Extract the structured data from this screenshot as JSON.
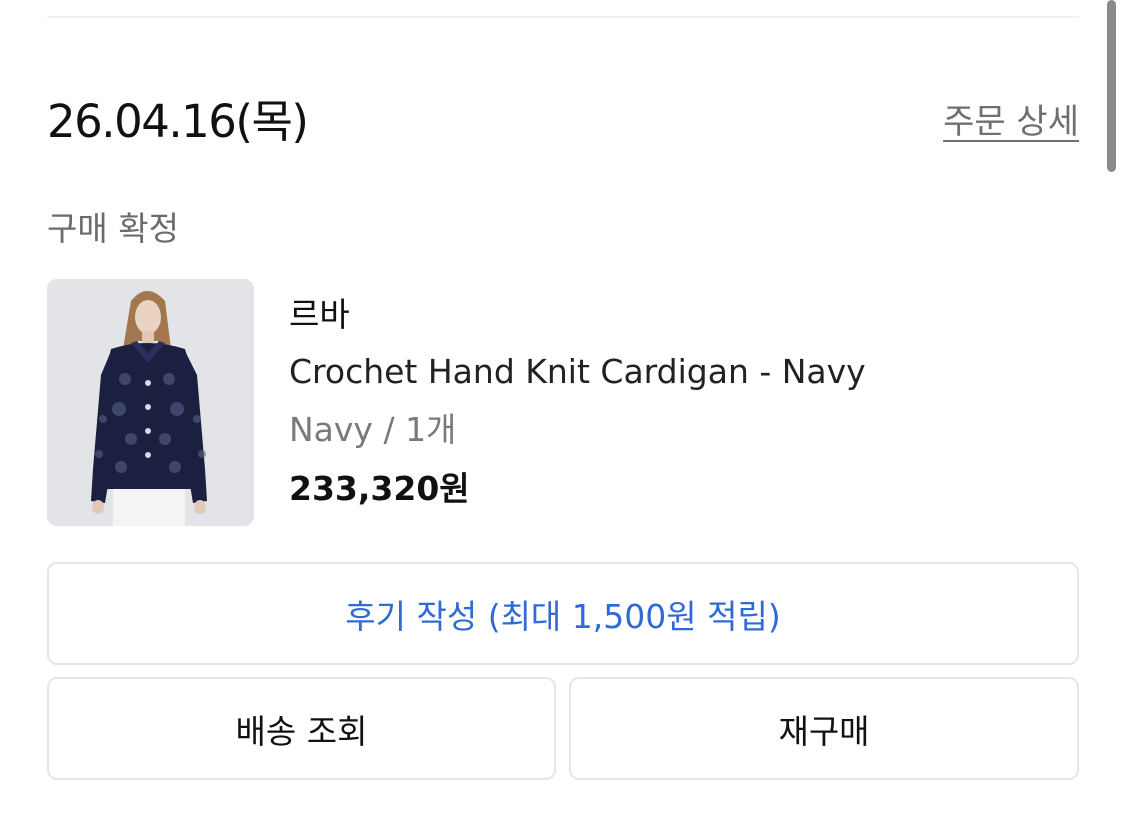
{
  "order": {
    "date": "26.04.16(목)",
    "detail_link": "주문 상세",
    "status": "구매 확정"
  },
  "product": {
    "thumbnail_icon": "product-photo",
    "brand": "르바",
    "name": "Crochet Hand Knit Cardigan - Navy",
    "option": "Navy / 1개",
    "price": "233,320원"
  },
  "actions": {
    "review": "후기 작성 (최대 1,500원 적립)",
    "track": "배송 조회",
    "rebuy": "재구매"
  },
  "colors": {
    "accent_link": "#2e6bd6",
    "muted_text": "#6f6f6f",
    "border": "#e6e6e6"
  }
}
